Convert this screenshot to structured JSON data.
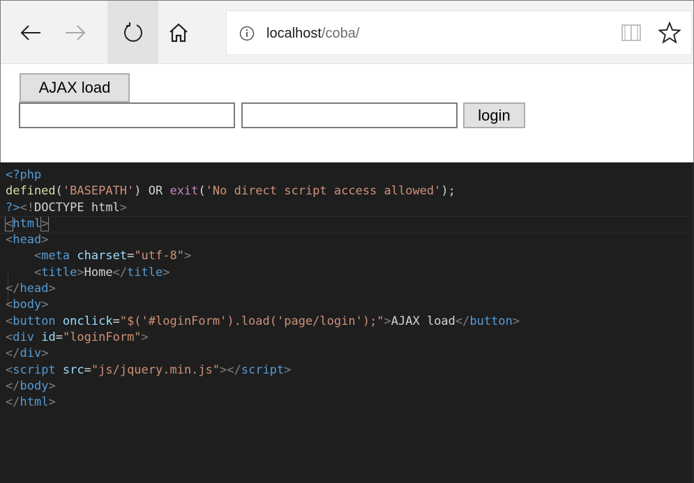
{
  "browser": {
    "nav": {
      "back_icon": "arrow-left-icon",
      "forward_icon": "arrow-right-icon",
      "refresh_icon": "refresh-icon",
      "home_icon": "home-icon"
    },
    "address_bar": {
      "host": "localhost",
      "path": "/coba/",
      "info_icon": "info-icon",
      "reading_view_icon": "reading-view-icon",
      "favorite_icon": "star-icon"
    }
  },
  "page": {
    "ajax_button_label": "AJAX load",
    "username_value": "",
    "password_value": "",
    "login_button_label": "login"
  },
  "editor": {
    "colors": {
      "background": "#1e1e1e",
      "tag": "#569cd6",
      "attribute": "#9cdcfe",
      "string": "#ce9178",
      "function": "#dcdcaa",
      "keyword": "#c586c0"
    },
    "lines": [
      [
        {
          "t": "<?php",
          "c": "tag"
        }
      ],
      [
        {
          "t": "defined",
          "c": "fn"
        },
        {
          "t": "(",
          "c": "plain"
        },
        {
          "t": "'BASEPATH'",
          "c": "str"
        },
        {
          "t": ") OR ",
          "c": "plain"
        },
        {
          "t": "exit",
          "c": "kw"
        },
        {
          "t": "(",
          "c": "plain"
        },
        {
          "t": "'No direct script access allowed'",
          "c": "str"
        },
        {
          "t": ");",
          "c": "plain"
        }
      ],
      [
        {
          "t": "?>",
          "c": "tag"
        },
        {
          "t": "<!",
          "c": "punc"
        },
        {
          "t": "DOCTYPE html",
          "c": "plain"
        },
        {
          "t": ">",
          "c": "punc"
        }
      ],
      [
        {
          "t": "<",
          "c": "punc",
          "b": true
        },
        {
          "t": "html",
          "c": "tag"
        },
        {
          "t": ">",
          "c": "punc",
          "b": true
        }
      ],
      [
        {
          "t": "<",
          "c": "punc"
        },
        {
          "t": "head",
          "c": "tag"
        },
        {
          "t": ">",
          "c": "punc"
        }
      ],
      [
        {
          "t": "    ",
          "c": "plain"
        },
        {
          "t": "<",
          "c": "punc"
        },
        {
          "t": "meta",
          "c": "tag"
        },
        {
          "t": " ",
          "c": "plain"
        },
        {
          "t": "charset",
          "c": "attr"
        },
        {
          "t": "=",
          "c": "plain"
        },
        {
          "t": "\"utf-8\"",
          "c": "str"
        },
        {
          "t": ">",
          "c": "punc"
        }
      ],
      [
        {
          "t": "    ",
          "c": "plain"
        },
        {
          "t": "<",
          "c": "punc"
        },
        {
          "t": "title",
          "c": "tag"
        },
        {
          "t": ">",
          "c": "punc"
        },
        {
          "t": "Home",
          "c": "plain"
        },
        {
          "t": "</",
          "c": "punc"
        },
        {
          "t": "title",
          "c": "tag"
        },
        {
          "t": ">",
          "c": "punc"
        }
      ],
      [
        {
          "t": "</",
          "c": "punc"
        },
        {
          "t": "head",
          "c": "tag"
        },
        {
          "t": ">",
          "c": "punc"
        }
      ],
      [
        {
          "t": "<",
          "c": "punc"
        },
        {
          "t": "body",
          "c": "tag"
        },
        {
          "t": ">",
          "c": "punc"
        }
      ],
      [
        {
          "t": "<",
          "c": "punc"
        },
        {
          "t": "button",
          "c": "tag"
        },
        {
          "t": " ",
          "c": "plain"
        },
        {
          "t": "onclick",
          "c": "attr"
        },
        {
          "t": "=",
          "c": "plain"
        },
        {
          "t": "\"$('#loginForm').load('page/login');\"",
          "c": "str"
        },
        {
          "t": ">",
          "c": "punc"
        },
        {
          "t": "AJAX load",
          "c": "plain"
        },
        {
          "t": "</",
          "c": "punc"
        },
        {
          "t": "button",
          "c": "tag"
        },
        {
          "t": ">",
          "c": "punc"
        }
      ],
      [
        {
          "t": "<",
          "c": "punc"
        },
        {
          "t": "div",
          "c": "tag"
        },
        {
          "t": " ",
          "c": "plain"
        },
        {
          "t": "id",
          "c": "attr"
        },
        {
          "t": "=",
          "c": "plain"
        },
        {
          "t": "\"loginForm\"",
          "c": "str"
        },
        {
          "t": ">",
          "c": "punc"
        }
      ],
      [
        {
          "t": "</",
          "c": "punc"
        },
        {
          "t": "div",
          "c": "tag"
        },
        {
          "t": ">",
          "c": "punc"
        }
      ],
      [
        {
          "t": "<",
          "c": "punc"
        },
        {
          "t": "script",
          "c": "tag"
        },
        {
          "t": " ",
          "c": "plain"
        },
        {
          "t": "src",
          "c": "attr"
        },
        {
          "t": "=",
          "c": "plain"
        },
        {
          "t": "\"js/jquery.min.js\"",
          "c": "str"
        },
        {
          "t": "></",
          "c": "punc"
        },
        {
          "t": "script",
          "c": "tag"
        },
        {
          "t": ">",
          "c": "punc"
        }
      ],
      [
        {
          "t": "</",
          "c": "punc"
        },
        {
          "t": "body",
          "c": "tag"
        },
        {
          "t": ">",
          "c": "punc"
        }
      ],
      [
        {
          "t": "</",
          "c": "punc"
        },
        {
          "t": "html",
          "c": "tag"
        },
        {
          "t": ">",
          "c": "punc"
        }
      ]
    ]
  }
}
